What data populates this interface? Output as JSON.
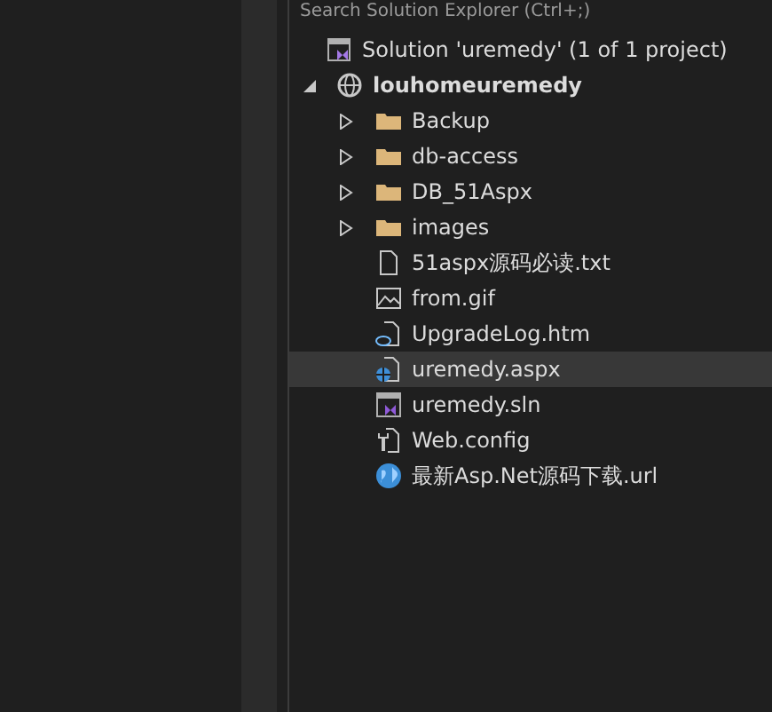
{
  "search": {
    "placeholder": "Search Solution Explorer (Ctrl+;)"
  },
  "tree": [
    {
      "label": "Solution 'uremedy' (1 of 1 project)",
      "kind": "solution",
      "selected": false,
      "children": [
        {
          "label": "louhomeuremedy",
          "kind": "project",
          "expanded": true,
          "selected": false,
          "children": [
            {
              "label": "Backup",
              "kind": "folder",
              "expanded": false,
              "selected": false
            },
            {
              "label": "db-access",
              "kind": "folder",
              "expanded": false,
              "selected": false
            },
            {
              "label": "DB_51Aspx",
              "kind": "folder",
              "expanded": false,
              "selected": false
            },
            {
              "label": "images",
              "kind": "folder",
              "expanded": false,
              "selected": false
            },
            {
              "label": "51aspx源码必读.txt",
              "kind": "text",
              "selected": false
            },
            {
              "label": "from.gif",
              "kind": "image",
              "selected": false
            },
            {
              "label": "UpgradeLog.htm",
              "kind": "html",
              "selected": false
            },
            {
              "label": "uremedy.aspx",
              "kind": "aspx",
              "selected": true
            },
            {
              "label": "uremedy.sln",
              "kind": "sln",
              "selected": false
            },
            {
              "label": "Web.config",
              "kind": "config",
              "selected": false
            },
            {
              "label": "最新Asp.Net源码下载.url",
              "kind": "url",
              "selected": false
            }
          ]
        }
      ]
    }
  ]
}
